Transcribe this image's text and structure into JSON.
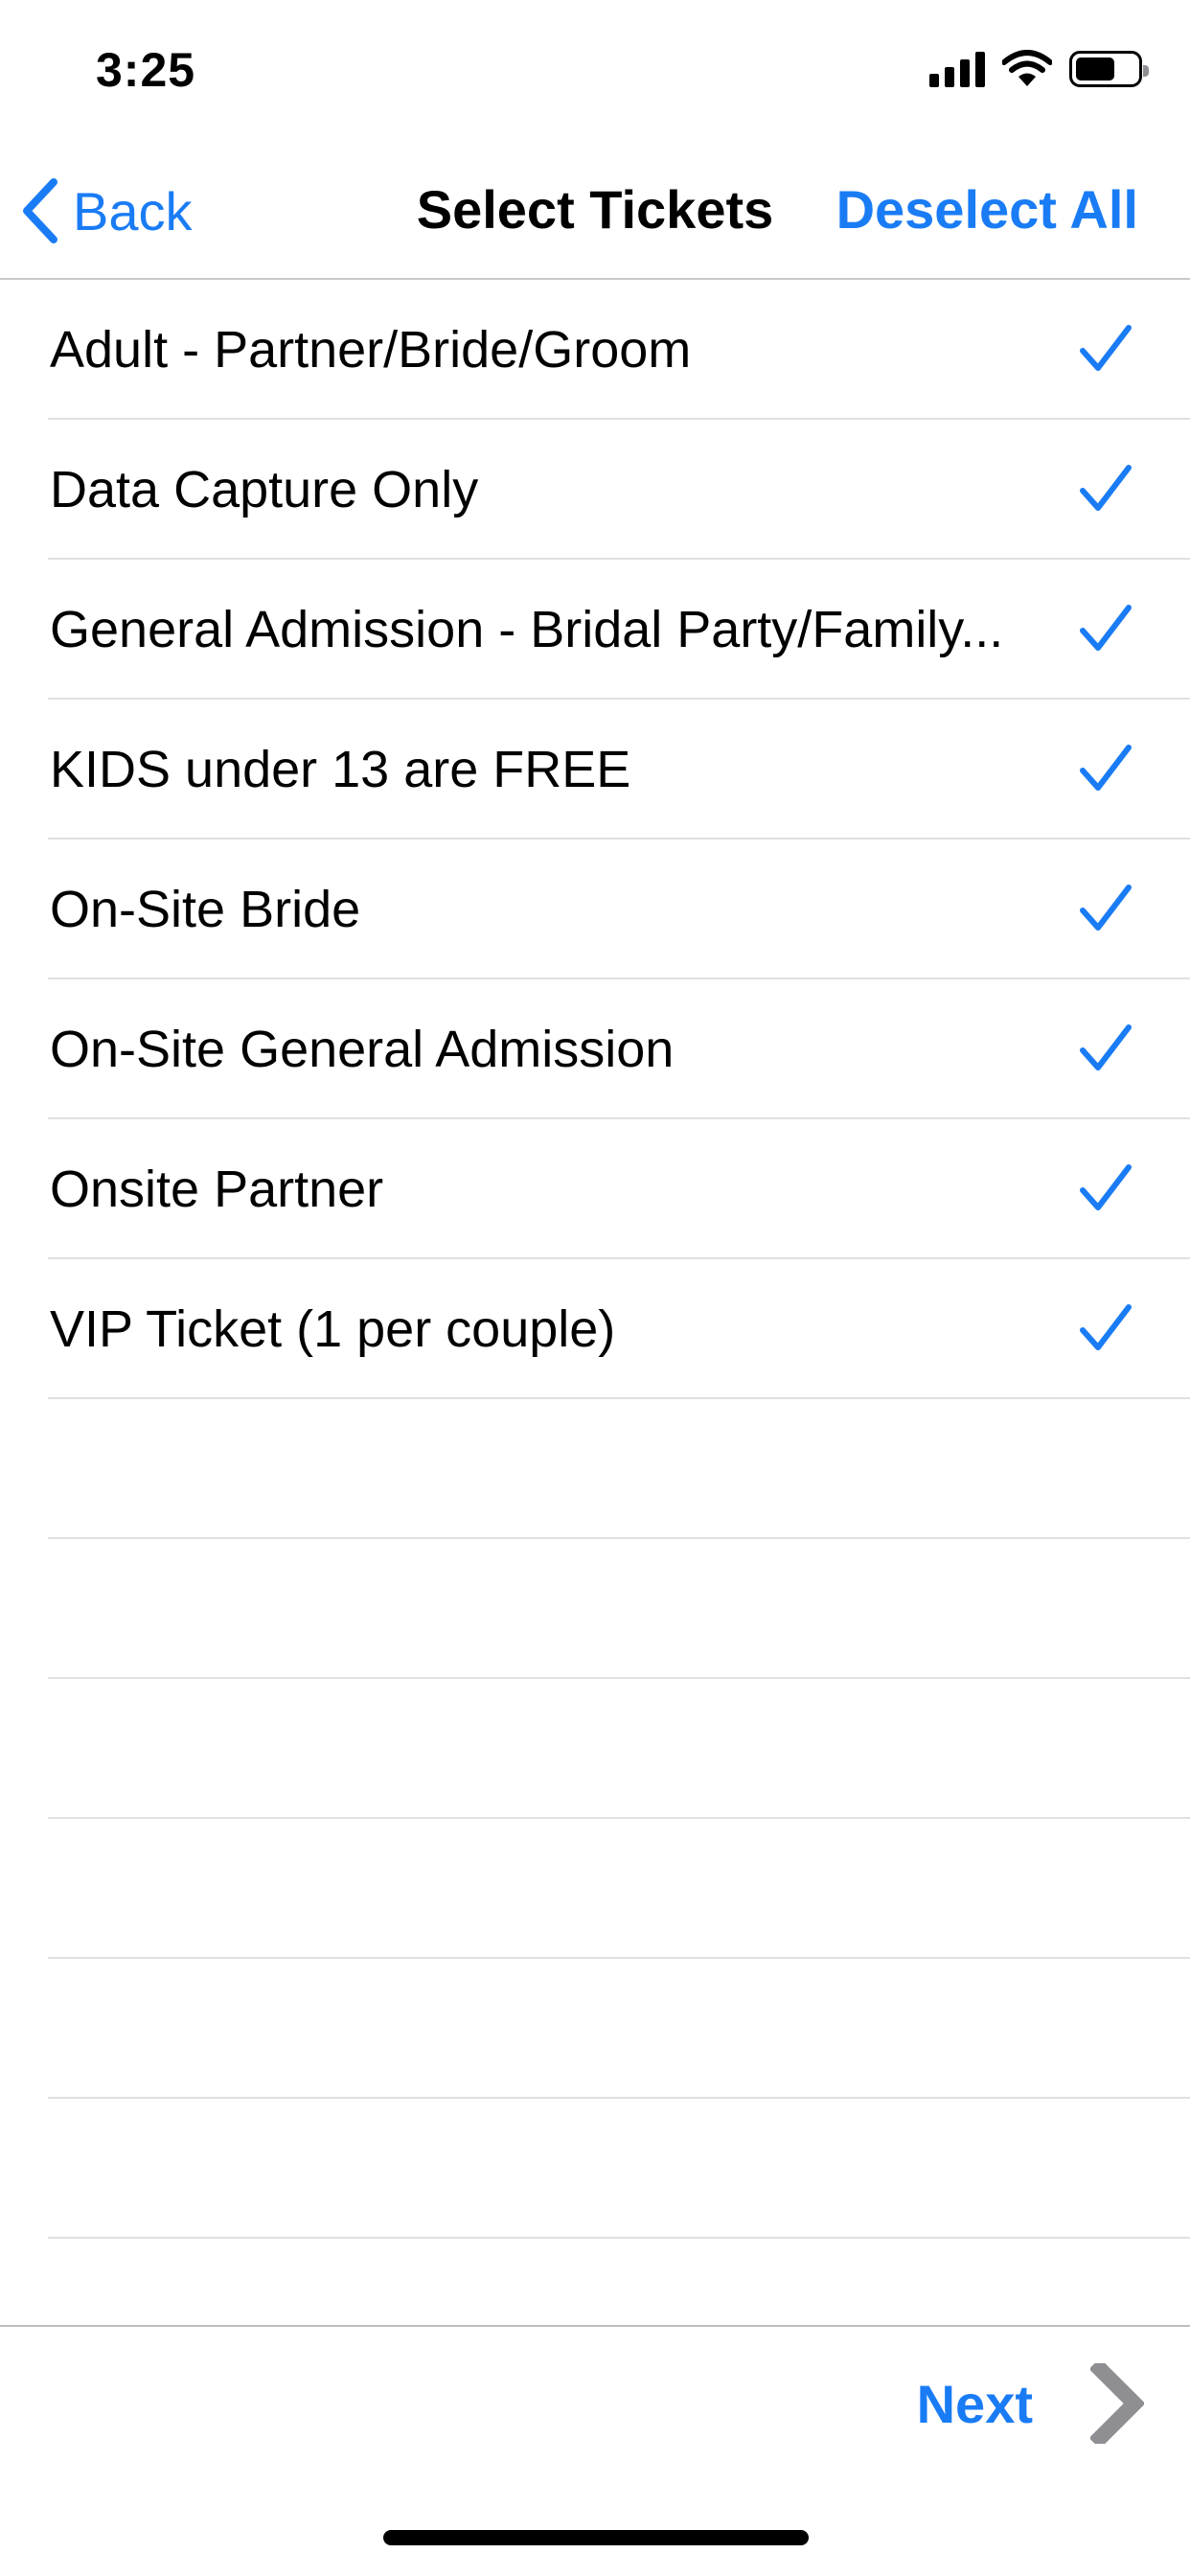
{
  "status_bar": {
    "time": "3:25",
    "icons": [
      "signal-icon",
      "wifi-icon",
      "battery-icon"
    ]
  },
  "nav": {
    "back_label": "Back",
    "title": "Select Tickets",
    "deselect_label": "Deselect All"
  },
  "tickets": [
    {
      "label": "Adult - Partner/Bride/Groom",
      "selected": true
    },
    {
      "label": "Data Capture Only",
      "selected": true
    },
    {
      "label": "General Admission - Bridal Party/Family...",
      "selected": true
    },
    {
      "label": "KIDS under 13 are FREE",
      "selected": true
    },
    {
      "label": "On-Site Bride",
      "selected": true
    },
    {
      "label": "On-Site General Admission",
      "selected": true
    },
    {
      "label": "Onsite Partner",
      "selected": true
    },
    {
      "label": "VIP Ticket (1 per couple)",
      "selected": true
    }
  ],
  "footer": {
    "next_label": "Next"
  },
  "colors": {
    "accent": "#1a7cf5",
    "separator": "#e0e0e4",
    "chevron": "#8e8e93"
  }
}
